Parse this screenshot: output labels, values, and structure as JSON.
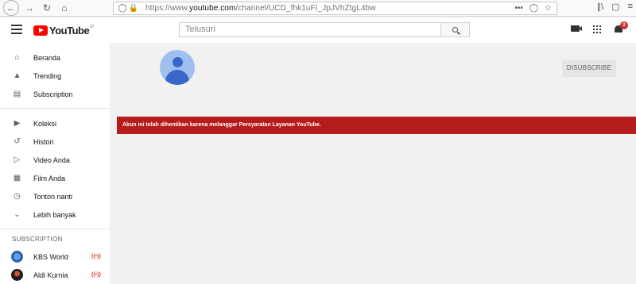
{
  "browser": {
    "url_prefix": "https://www.",
    "url_domain": "youtube.com",
    "url_path": "/channel/UCD_fhk1uFI_JpJVhZtgL4bw",
    "menu_dots": "•••"
  },
  "yt": {
    "logo_text": "YouTube",
    "logo_region": "ID",
    "search_placeholder": "Telusuri",
    "notification_count": "2"
  },
  "sidebar": {
    "primary": [
      {
        "label": "Beranda",
        "icon": "home-icon"
      },
      {
        "label": "Trending",
        "icon": "flame-icon"
      },
      {
        "label": "Subscription",
        "icon": "subscriptions-icon"
      }
    ],
    "library": [
      {
        "label": "Koleksi",
        "icon": "library-icon"
      },
      {
        "label": "Histori",
        "icon": "history-icon"
      },
      {
        "label": "Video Anda",
        "icon": "your-videos-icon"
      },
      {
        "label": "Film Anda",
        "icon": "film-icon"
      },
      {
        "label": "Tonton nanti",
        "icon": "watch-later-icon"
      },
      {
        "label": "Lebih banyak",
        "icon": "chevron-down-icon"
      }
    ],
    "subscriptions_heading": "SUBSCRIPTION",
    "subscriptions": [
      {
        "name": "KBS World",
        "live": "((•))"
      },
      {
        "name": "Aldi Kurnia",
        "live": "((•))"
      }
    ]
  },
  "channel": {
    "unsubscribe_label": "DISUBSCRIBE",
    "termination_message": "Akun ini telah dihentikan karena melanggar Persyaratan Layanan YouTube."
  },
  "colors": {
    "brand_red": "#ff0000",
    "banner_red": "#b71c1c",
    "avatar_blue": "#3a66c9"
  }
}
